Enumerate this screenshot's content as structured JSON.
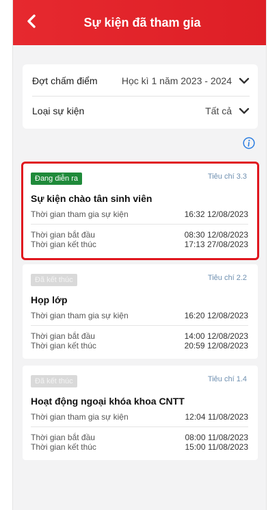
{
  "header": {
    "title": "Sự kiện đã tham gia"
  },
  "filters": {
    "period_label": "Đợt chấm điểm",
    "period_value": "Học kì 1 năm 2023 - 2024",
    "type_label": "Loại sự kiện",
    "type_value": "Tất cả"
  },
  "events": [
    {
      "status": "Đang diễn ra",
      "criteria": "Tiêu chí 3.3",
      "name": "Sự kiện chào tân sinh viên",
      "join_label": "Thời gian tham gia sự kiện",
      "join_value": "16:32 12/08/2023",
      "start_label": "Thời gian bắt đầu",
      "start_value": "08:30 12/08/2023",
      "end_label": "Thời gian kết thúc",
      "end_value": "17:13 27/08/2023"
    },
    {
      "status": "Đã kết thúc",
      "criteria": "Tiêu chí 2.2",
      "name": "Họp lớp",
      "join_label": "Thời gian tham gia sự kiện",
      "join_value": "16:20 12/08/2023",
      "start_label": "Thời gian bắt đầu",
      "start_value": "14:00 12/08/2023",
      "end_label": "Thời gian kết thúc",
      "end_value": "20:59 12/08/2023"
    },
    {
      "status": "Đã kết thúc",
      "criteria": "Tiêu chí 1.4",
      "name": "Hoạt động ngoại khóa khoa CNTT",
      "join_label": "Thời gian tham gia sự kiện",
      "join_value": "12:04 11/08/2023",
      "start_label": "Thời gian bắt đầu",
      "start_value": "08:00 11/08/2023",
      "end_label": "Thời gian kết thúc",
      "end_value": "15:00 11/08/2023"
    }
  ],
  "colors": {
    "header_red": "#e6292f",
    "active_badge": "#1f8a3a",
    "done_badge": "#d9d9d9",
    "criteria_text": "#6e8fb0",
    "highlight_border": "#e0161e",
    "info_icon": "#2a7de1"
  },
  "icons": {
    "back": "chevron-left-icon",
    "dropdown": "chevron-down-icon",
    "info": "info-icon"
  }
}
